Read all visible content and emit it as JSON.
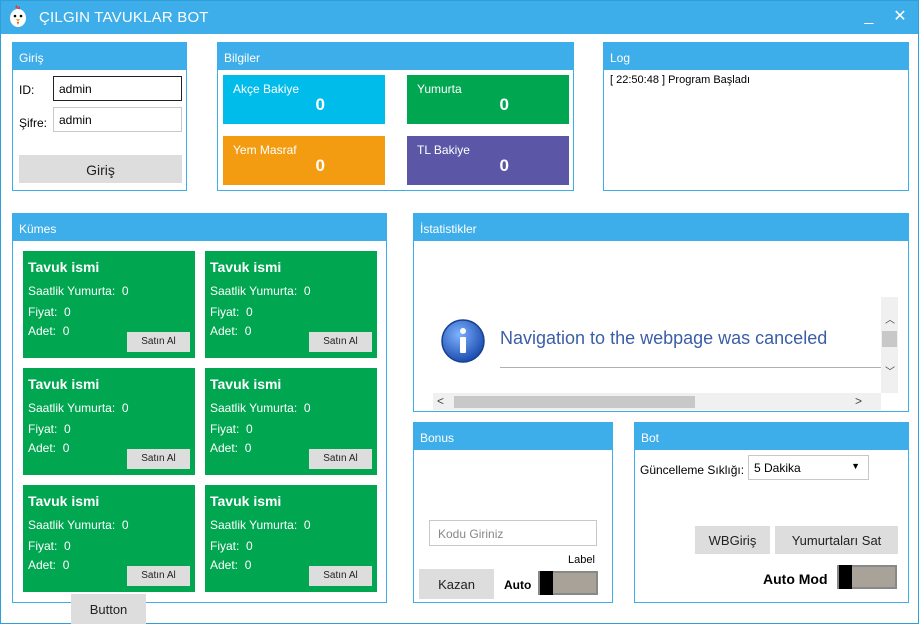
{
  "window": {
    "title": "ÇILGIN TAVUKLAR BOT",
    "minimize": "_",
    "close": "✕"
  },
  "login": {
    "header": "Giriş",
    "id_label": "ID:",
    "id_value": "admin",
    "password_label": "Şifre:",
    "password_value": "admin",
    "button": "Giriş"
  },
  "info": {
    "header": "Bilgiler",
    "tiles": [
      {
        "label": "Akçe Bakiye",
        "value": "0",
        "color": "#00bcea"
      },
      {
        "label": "Yumurta",
        "value": "0",
        "color": "#00a650"
      },
      {
        "label": "Yem Masraf",
        "value": "0",
        "color": "#f39c12"
      },
      {
        "label": "TL Bakiye",
        "value": "0",
        "color": "#5b57a6"
      }
    ]
  },
  "log": {
    "header": "Log",
    "entries": [
      "[ 22:50:48 ]  Program Başladı"
    ]
  },
  "coop": {
    "header": "Kümes",
    "cards": [
      {
        "name": "Tavuk ismi",
        "hourly_label": "Saatlik Yumurta:",
        "hourly": "0",
        "price_label": "Fiyat:",
        "price": "0",
        "count_label": "Adet:",
        "count": "0",
        "buy": "Satın Al"
      },
      {
        "name": "Tavuk ismi",
        "hourly_label": "Saatlik Yumurta:",
        "hourly": "0",
        "price_label": "Fiyat:",
        "price": "0",
        "count_label": "Adet:",
        "count": "0",
        "buy": "Satın Al"
      },
      {
        "name": "Tavuk ismi",
        "hourly_label": "Saatlik Yumurta:",
        "hourly": "0",
        "price_label": "Fiyat:",
        "price": "0",
        "count_label": "Adet:",
        "count": "0",
        "buy": "Satın Al"
      },
      {
        "name": "Tavuk ismi",
        "hourly_label": "Saatlik Yumurta:",
        "hourly": "0",
        "price_label": "Fiyat:",
        "price": "0",
        "count_label": "Adet:",
        "count": "0",
        "buy": "Satın Al"
      },
      {
        "name": "Tavuk ismi",
        "hourly_label": "Saatlik Yumurta:",
        "hourly": "0",
        "price_label": "Fiyat:",
        "price": "0",
        "count_label": "Adet:",
        "count": "0",
        "buy": "Satın Al"
      },
      {
        "name": "Tavuk ismi",
        "hourly_label": "Saatlik Yumurta:",
        "hourly": "0",
        "price_label": "Fiyat:",
        "price": "0",
        "count_label": "Adet:",
        "count": "0",
        "buy": "Satın Al"
      }
    ],
    "extra_button": "Button"
  },
  "stats": {
    "header": "İstatistikler",
    "browser_message": "Navigation to the webpage was canceled"
  },
  "bonus": {
    "header": "Bonus",
    "code_placeholder": "Kodu Giriniz",
    "claim_button": "Kazan",
    "auto_label": "Auto",
    "toggle_label": "Label"
  },
  "bot": {
    "header": "Bot",
    "interval_label": "Güncelleme Sıklığı:",
    "interval_value": "5 Dakika",
    "wb_login_button": "WBGiriş",
    "sell_eggs_button": "Yumurtaları Sat",
    "auto_mode_label": "Auto Mod"
  },
  "icons": [
    "chicken-app-icon",
    "info-icon",
    "dropdown-arrow-icon",
    "scroll-up-icon",
    "scroll-down-icon",
    "scroll-left-icon",
    "scroll-right-icon"
  ]
}
